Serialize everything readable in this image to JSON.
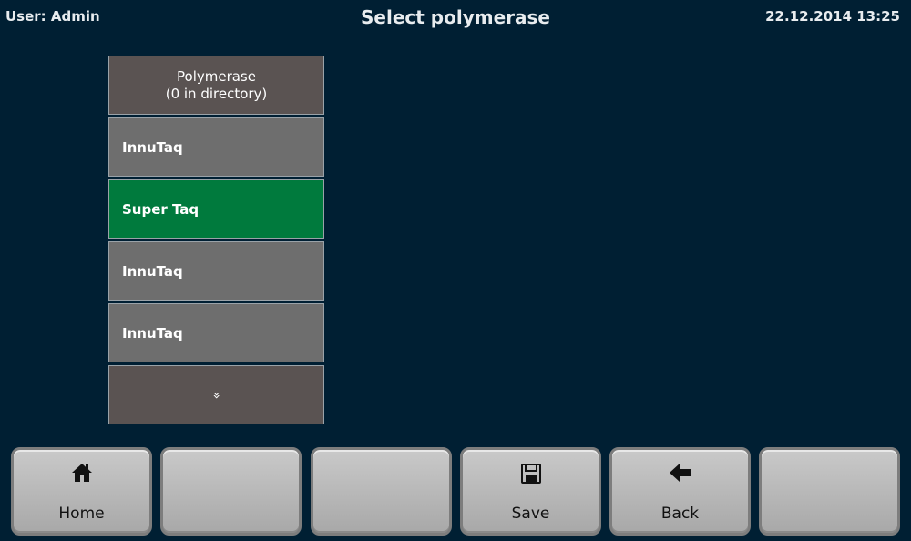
{
  "header": {
    "user": "User: Admin",
    "title": "Select polymerase",
    "datetime": "22.12.2014 13:25"
  },
  "list": {
    "header_line1": "Polymerase",
    "header_line2": "(0 in directory)",
    "items": [
      {
        "label": "InnuTaq",
        "selected": false
      },
      {
        "label": "Super Taq",
        "selected": true
      },
      {
        "label": "InnuTaq",
        "selected": false
      },
      {
        "label": "InnuTaq",
        "selected": false
      }
    ],
    "more_glyph": "»"
  },
  "toolbar": {
    "home_label": "Home",
    "save_label": "Save",
    "back_label": "Back"
  },
  "colors": {
    "background": "#001f33",
    "selected": "#007a3d",
    "item": "#6e6e6e",
    "header_cell": "#5a5352"
  },
  "icons": {
    "home": "home-icon",
    "save": "floppy-disk-icon",
    "back": "arrow-left-icon",
    "more": "double-chevron-down-icon"
  }
}
